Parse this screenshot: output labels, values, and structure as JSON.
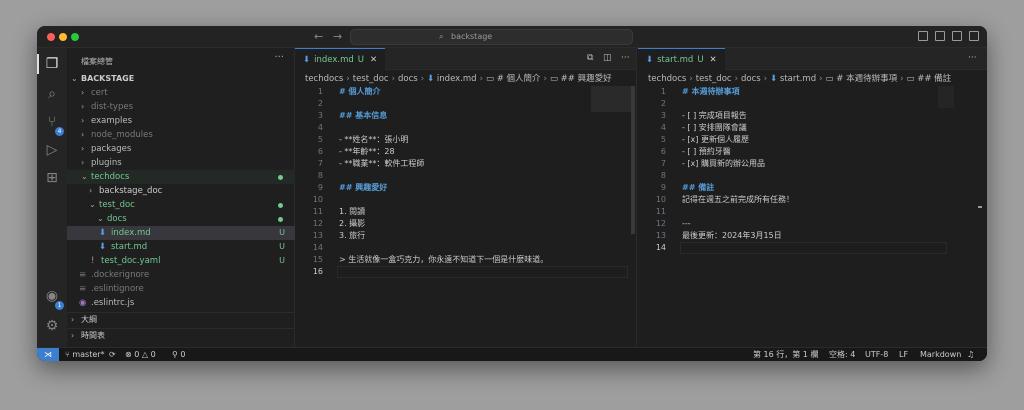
{
  "titlebar": {
    "search_text": "backstage",
    "search_icon": "search-icon",
    "back_icon": "arrow-left-icon",
    "forward_icon": "arrow-right-icon"
  },
  "activity": {
    "scm_badge": "4",
    "account_badge": "1"
  },
  "sidebar": {
    "title": "檔案總管",
    "root": "BACKSTAGE",
    "items": [
      {
        "label": "cert"
      },
      {
        "label": "dist-types"
      },
      {
        "label": "examples"
      },
      {
        "label": "node_modules"
      },
      {
        "label": "packages"
      },
      {
        "label": "plugins"
      },
      {
        "label": "techdocs"
      },
      {
        "label": "backstage_doc"
      },
      {
        "label": "test_doc"
      },
      {
        "label": "docs"
      },
      {
        "label": "index.md",
        "status": "U"
      },
      {
        "label": "start.md",
        "status": "U"
      },
      {
        "label": "test_doc.yaml",
        "status": "U"
      },
      {
        "label": ".dockerignore"
      },
      {
        "label": ".eslintignore"
      },
      {
        "label": ".eslintrc.js"
      }
    ],
    "outline": "大綱",
    "timeline": "時間表"
  },
  "left_editor": {
    "tab_label": "index.md",
    "tab_status": "U",
    "breadcrumb": [
      "techdocs",
      "test_doc",
      "docs",
      "index.md",
      "# 個人簡介",
      "## 興趣愛好"
    ],
    "lines": [
      {
        "n": "1",
        "text": "# 個人簡介"
      },
      {
        "n": "2",
        "text": ""
      },
      {
        "n": "3",
        "text": "## 基本信息"
      },
      {
        "n": "4",
        "text": ""
      },
      {
        "n": "5",
        "text": "- **姓名**：張小明"
      },
      {
        "n": "6",
        "text": "- **年齡**：28"
      },
      {
        "n": "7",
        "text": "- **職業**：軟件工程師"
      },
      {
        "n": "8",
        "text": ""
      },
      {
        "n": "9",
        "text": "## 興趣愛好"
      },
      {
        "n": "10",
        "text": ""
      },
      {
        "n": "11",
        "text": "1. 閱讀"
      },
      {
        "n": "12",
        "text": "2. 攝影"
      },
      {
        "n": "13",
        "text": "3. 旅行"
      },
      {
        "n": "14",
        "text": ""
      },
      {
        "n": "15",
        "text": "> 生活就像一盒巧克力，你永遠不知道下一個是什麼味道。"
      },
      {
        "n": "16",
        "text": ""
      }
    ]
  },
  "right_editor": {
    "tab_label": "start.md",
    "tab_status": "U",
    "breadcrumb": [
      "techdocs",
      "test_doc",
      "docs",
      "start.md",
      "# 本週待辦事項",
      "## 備註"
    ],
    "lines": [
      {
        "n": "1",
        "text": "# 本週待辦事項"
      },
      {
        "n": "2",
        "text": ""
      },
      {
        "n": "3",
        "text": "- [ ] 完成項目報告"
      },
      {
        "n": "4",
        "text": "- [ ] 安排團隊會議"
      },
      {
        "n": "5",
        "text": "- [x] 更新個人履歷"
      },
      {
        "n": "6",
        "text": "- [ ] 預約牙醫"
      },
      {
        "n": "7",
        "text": "- [x] 購買新的辦公用品"
      },
      {
        "n": "8",
        "text": ""
      },
      {
        "n": "9",
        "text": "## 備註"
      },
      {
        "n": "10",
        "text": "記得在週五之前完成所有任務！"
      },
      {
        "n": "11",
        "text": ""
      },
      {
        "n": "12",
        "text": "---"
      },
      {
        "n": "13",
        "text": "最後更新：2024年3月15日"
      },
      {
        "n": "14",
        "text": ""
      }
    ]
  },
  "statusbar": {
    "branch": "master*",
    "errors": "0",
    "warnings": "0",
    "ports": "0",
    "position": "第 16 行，第 1 欄",
    "spaces": "空格: 4",
    "encoding": "UTF-8",
    "eol": "LF",
    "language": "Markdown"
  },
  "colors": {
    "accent": "#3c7fd0",
    "untracked": "#73c991",
    "heading": "#569cd6"
  }
}
